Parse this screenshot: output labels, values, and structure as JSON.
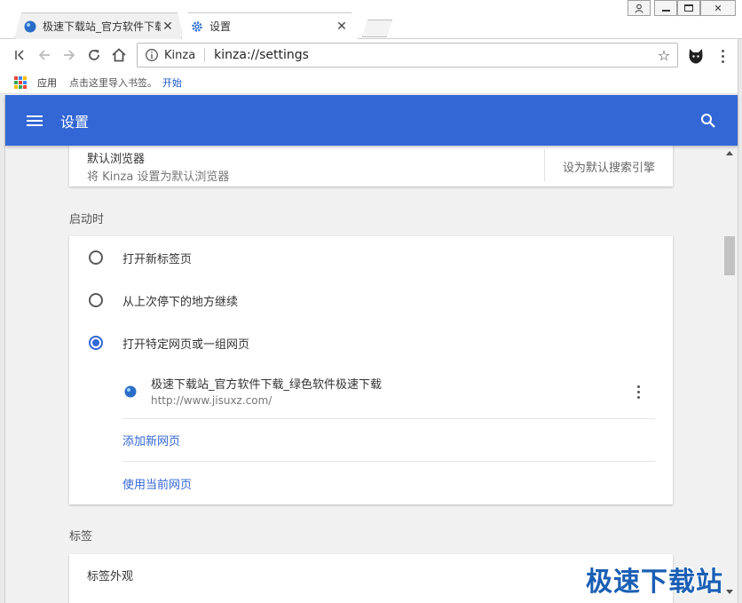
{
  "tabs": [
    {
      "title": "极速下载站_官方软件下载_绿色软件极速下载",
      "active": false
    },
    {
      "title": "设置",
      "active": true
    }
  ],
  "toolbar": {
    "site_name": "Kinza",
    "url": "kinza://settings"
  },
  "bookmarks": {
    "apps_label": "应用",
    "hint": "点击这里导入书签。",
    "start_link": "开始"
  },
  "header": {
    "title": "设置"
  },
  "default_browser": {
    "title": "默认浏览器",
    "subtitle": "将 Kinza 设置为默认浏览器",
    "action": "设为默认搜索引擎"
  },
  "startup": {
    "section_label": "启动时",
    "options": [
      {
        "label": "打开新标签页",
        "checked": false
      },
      {
        "label": "从上次停下的地方继续",
        "checked": false
      },
      {
        "label": "打开特定网页或一组网页",
        "checked": true
      }
    ],
    "page": {
      "name": "极速下载站_官方软件下载_绿色软件极速下载",
      "url": "http://www.jisuxz.com/"
    },
    "add_page": "添加新网页",
    "use_current": "使用当前网页"
  },
  "tabs_section": {
    "section_label": "标签",
    "appearance": "标签外观"
  },
  "watermark": "极速下载站",
  "colors": {
    "header_blue": "#3367d6",
    "link_blue": "#3367d6",
    "favicon_blue": "#2a6dc9"
  },
  "icons": [
    "favicon-icon",
    "settings-gear-icon",
    "close-icon",
    "back-to-start-icon",
    "back-icon",
    "forward-icon",
    "reload-icon",
    "home-icon",
    "info-icon",
    "star-icon",
    "extension-icon",
    "menu-icon",
    "apps-icon",
    "hamburger-icon",
    "search-icon"
  ]
}
